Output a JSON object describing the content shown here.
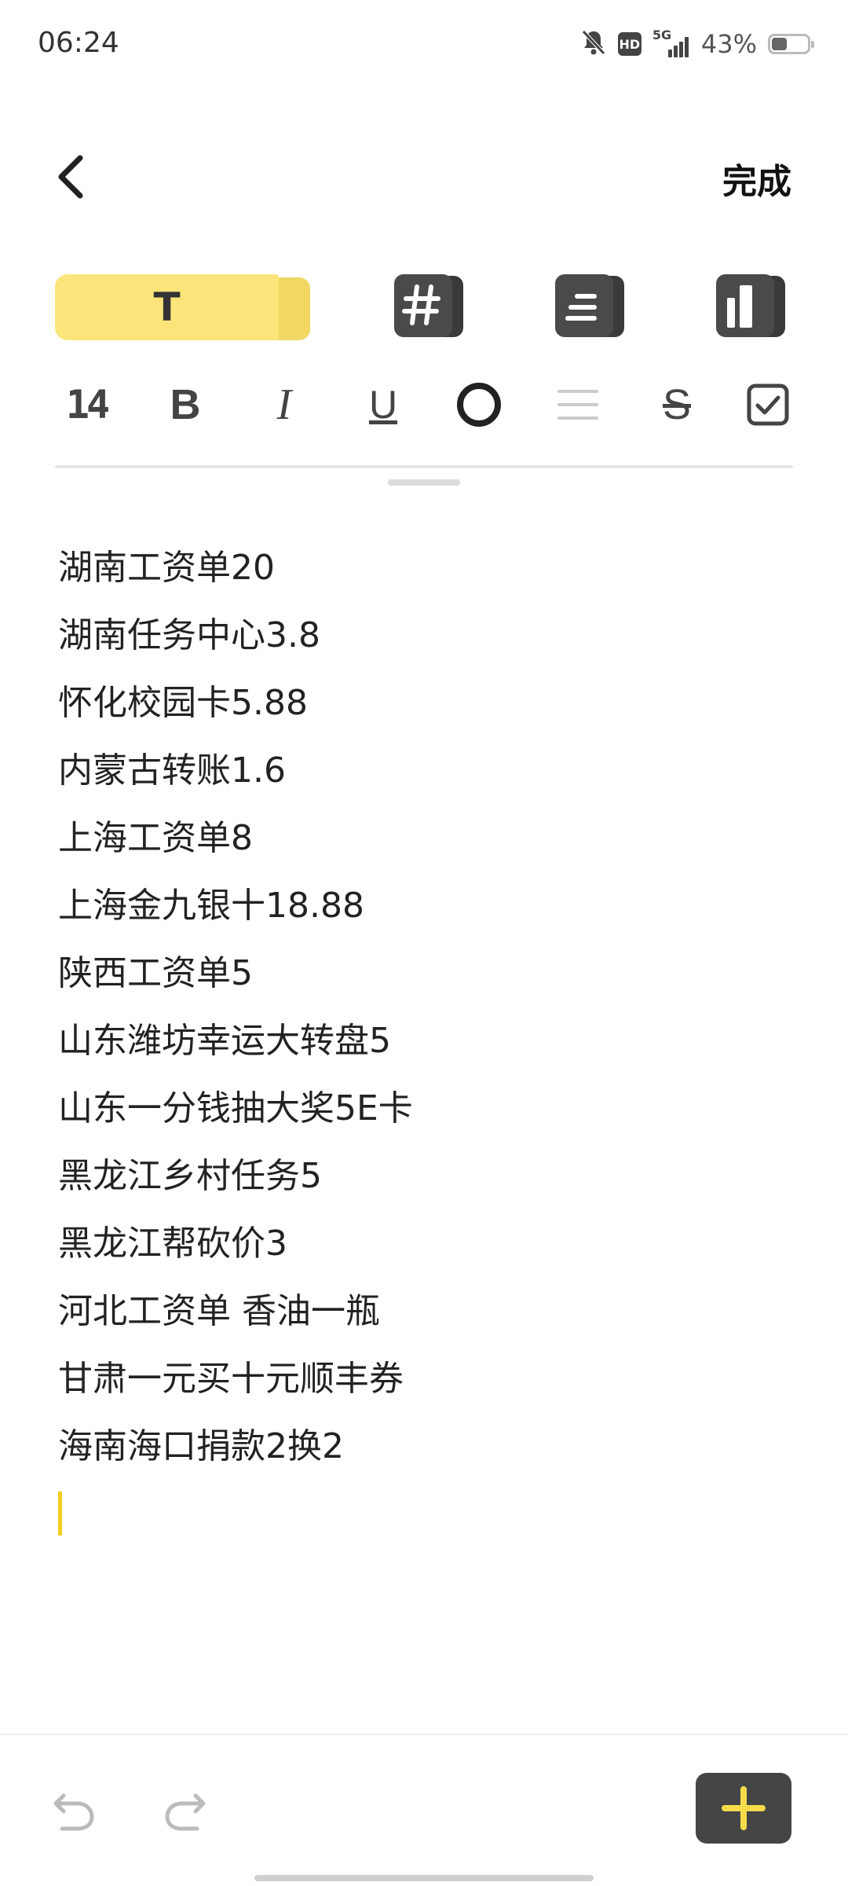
{
  "status_bar": {
    "time": "06:24",
    "battery_text": "43%",
    "battery_level": 0.43,
    "network": "5G",
    "hd_label": "HD",
    "icons": [
      "mute-bell-icon",
      "hd-icon",
      "signal-5g-icon",
      "battery-icon"
    ]
  },
  "header": {
    "back_icon": "chevron-left-icon",
    "done_label": "完成"
  },
  "style_tabs": {
    "text_tab_label": "T",
    "active_color": "#fbe57a",
    "icons": [
      "text-style-icon",
      "hash-heading-icon",
      "list-lines-icon",
      "column-layout-icon"
    ]
  },
  "format_toolbar": {
    "font_size": "14",
    "bold": "B",
    "italic": "I",
    "underline": "U",
    "strike": "S",
    "icons": [
      "font-size-icon",
      "bold-icon",
      "italic-icon",
      "underline-icon",
      "circle-color-icon",
      "align-lines-icon",
      "strikethrough-icon",
      "checkbox-icon"
    ]
  },
  "note": {
    "lines": [
      "湖南工资单20",
      "湖南任务中心3.8",
      "怀化校园卡5.88",
      "内蒙古转账1.6",
      "上海工资单8",
      "上海金九银十18.88",
      "陕西工资单5",
      "山东潍坊幸运大转盘5",
      "山东一分钱抽大奖5E卡",
      "黑龙江乡村任务5",
      "黑龙江帮砍价3",
      "河北工资单 香油一瓶",
      "甘肃一元买十元顺丰券",
      "海南海口捐款2换2"
    ],
    "caret_color": "#f3cd1f"
  },
  "bottom_bar": {
    "icons": [
      "undo-icon",
      "redo-icon",
      "plus-icon"
    ],
    "add_color": "#f6dc4a"
  }
}
